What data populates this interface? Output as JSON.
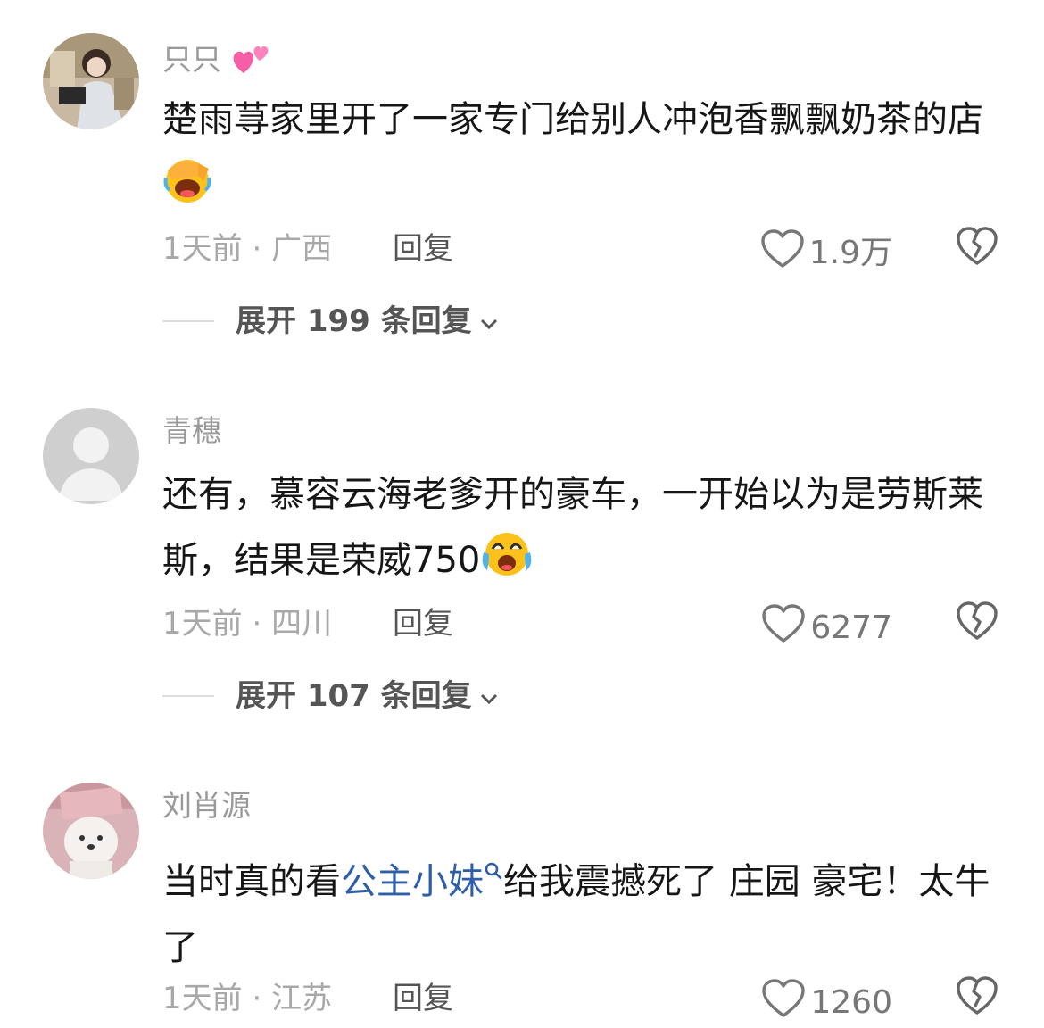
{
  "comments": [
    {
      "username": "只只",
      "text_before_emoji": "楚雨荨家里开了一家专门给别人冲泡香飘飘奶茶的店",
      "emoji": "facepalm-laugh-emoji",
      "time": "1天前",
      "location": "广西",
      "reply": "回复",
      "likes": "1.9万",
      "expand": "展开 199 条回复"
    },
    {
      "username": "青穗",
      "text_before_emoji": "还有，慕容云海老爹开的豪车，一开始以为是劳斯莱斯，结果是荣威750",
      "emoji": "crying-laughing-emoji",
      "time": "1天前",
      "location": "四川",
      "reply": "回复",
      "likes": "6277",
      "expand": "展开 107 条回复"
    },
    {
      "username": "刘肖源",
      "text_part1": "当时真的看",
      "link_text": "公主小妹",
      "text_part2": "给我震撼死了 庄园 豪宅！太牛了",
      "time": "1天前",
      "location": "江苏",
      "reply": "回复",
      "likes": "1260"
    }
  ],
  "separator": "·",
  "colors": {
    "link": "#2f5ea8",
    "meta": "#a8a8a8",
    "text": "#161616"
  }
}
